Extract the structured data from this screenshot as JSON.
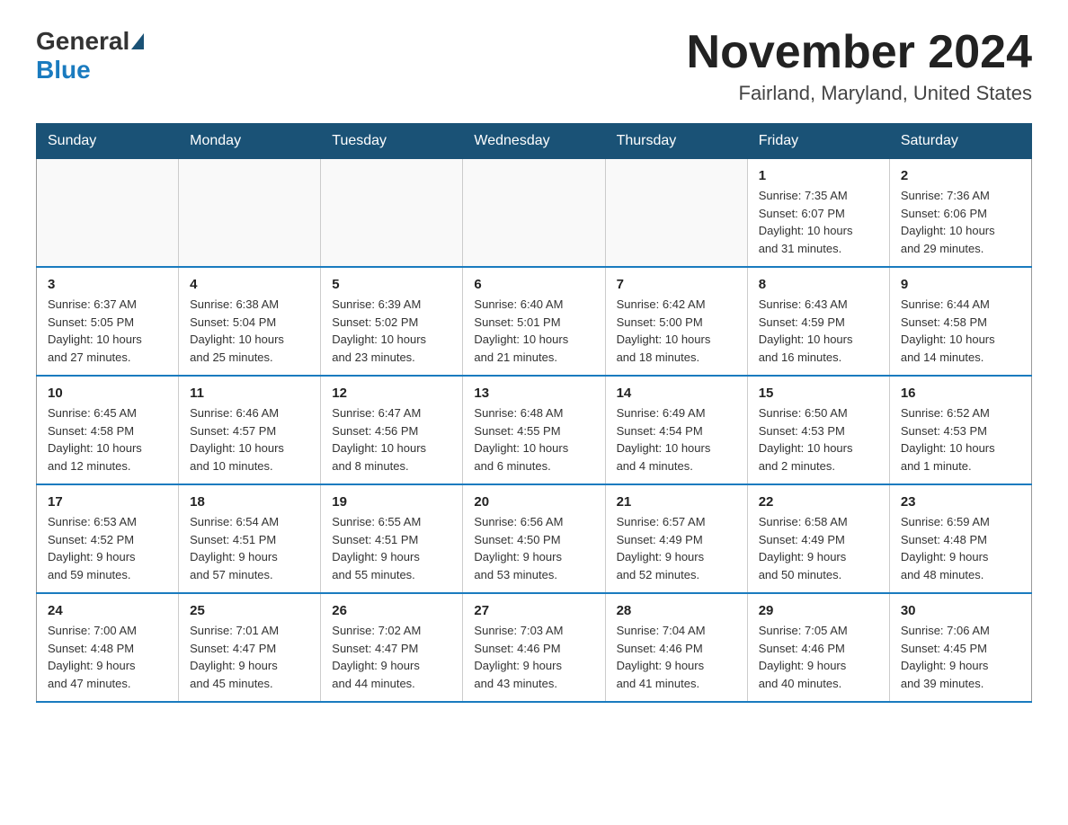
{
  "header": {
    "logo_general": "General",
    "logo_blue": "Blue",
    "month_title": "November 2024",
    "location": "Fairland, Maryland, United States"
  },
  "weekdays": [
    "Sunday",
    "Monday",
    "Tuesday",
    "Wednesday",
    "Thursday",
    "Friday",
    "Saturday"
  ],
  "weeks": [
    [
      {
        "day": "",
        "info": ""
      },
      {
        "day": "",
        "info": ""
      },
      {
        "day": "",
        "info": ""
      },
      {
        "day": "",
        "info": ""
      },
      {
        "day": "",
        "info": ""
      },
      {
        "day": "1",
        "info": "Sunrise: 7:35 AM\nSunset: 6:07 PM\nDaylight: 10 hours\nand 31 minutes."
      },
      {
        "day": "2",
        "info": "Sunrise: 7:36 AM\nSunset: 6:06 PM\nDaylight: 10 hours\nand 29 minutes."
      }
    ],
    [
      {
        "day": "3",
        "info": "Sunrise: 6:37 AM\nSunset: 5:05 PM\nDaylight: 10 hours\nand 27 minutes."
      },
      {
        "day": "4",
        "info": "Sunrise: 6:38 AM\nSunset: 5:04 PM\nDaylight: 10 hours\nand 25 minutes."
      },
      {
        "day": "5",
        "info": "Sunrise: 6:39 AM\nSunset: 5:02 PM\nDaylight: 10 hours\nand 23 minutes."
      },
      {
        "day": "6",
        "info": "Sunrise: 6:40 AM\nSunset: 5:01 PM\nDaylight: 10 hours\nand 21 minutes."
      },
      {
        "day": "7",
        "info": "Sunrise: 6:42 AM\nSunset: 5:00 PM\nDaylight: 10 hours\nand 18 minutes."
      },
      {
        "day": "8",
        "info": "Sunrise: 6:43 AM\nSunset: 4:59 PM\nDaylight: 10 hours\nand 16 minutes."
      },
      {
        "day": "9",
        "info": "Sunrise: 6:44 AM\nSunset: 4:58 PM\nDaylight: 10 hours\nand 14 minutes."
      }
    ],
    [
      {
        "day": "10",
        "info": "Sunrise: 6:45 AM\nSunset: 4:58 PM\nDaylight: 10 hours\nand 12 minutes."
      },
      {
        "day": "11",
        "info": "Sunrise: 6:46 AM\nSunset: 4:57 PM\nDaylight: 10 hours\nand 10 minutes."
      },
      {
        "day": "12",
        "info": "Sunrise: 6:47 AM\nSunset: 4:56 PM\nDaylight: 10 hours\nand 8 minutes."
      },
      {
        "day": "13",
        "info": "Sunrise: 6:48 AM\nSunset: 4:55 PM\nDaylight: 10 hours\nand 6 minutes."
      },
      {
        "day": "14",
        "info": "Sunrise: 6:49 AM\nSunset: 4:54 PM\nDaylight: 10 hours\nand 4 minutes."
      },
      {
        "day": "15",
        "info": "Sunrise: 6:50 AM\nSunset: 4:53 PM\nDaylight: 10 hours\nand 2 minutes."
      },
      {
        "day": "16",
        "info": "Sunrise: 6:52 AM\nSunset: 4:53 PM\nDaylight: 10 hours\nand 1 minute."
      }
    ],
    [
      {
        "day": "17",
        "info": "Sunrise: 6:53 AM\nSunset: 4:52 PM\nDaylight: 9 hours\nand 59 minutes."
      },
      {
        "day": "18",
        "info": "Sunrise: 6:54 AM\nSunset: 4:51 PM\nDaylight: 9 hours\nand 57 minutes."
      },
      {
        "day": "19",
        "info": "Sunrise: 6:55 AM\nSunset: 4:51 PM\nDaylight: 9 hours\nand 55 minutes."
      },
      {
        "day": "20",
        "info": "Sunrise: 6:56 AM\nSunset: 4:50 PM\nDaylight: 9 hours\nand 53 minutes."
      },
      {
        "day": "21",
        "info": "Sunrise: 6:57 AM\nSunset: 4:49 PM\nDaylight: 9 hours\nand 52 minutes."
      },
      {
        "day": "22",
        "info": "Sunrise: 6:58 AM\nSunset: 4:49 PM\nDaylight: 9 hours\nand 50 minutes."
      },
      {
        "day": "23",
        "info": "Sunrise: 6:59 AM\nSunset: 4:48 PM\nDaylight: 9 hours\nand 48 minutes."
      }
    ],
    [
      {
        "day": "24",
        "info": "Sunrise: 7:00 AM\nSunset: 4:48 PM\nDaylight: 9 hours\nand 47 minutes."
      },
      {
        "day": "25",
        "info": "Sunrise: 7:01 AM\nSunset: 4:47 PM\nDaylight: 9 hours\nand 45 minutes."
      },
      {
        "day": "26",
        "info": "Sunrise: 7:02 AM\nSunset: 4:47 PM\nDaylight: 9 hours\nand 44 minutes."
      },
      {
        "day": "27",
        "info": "Sunrise: 7:03 AM\nSunset: 4:46 PM\nDaylight: 9 hours\nand 43 minutes."
      },
      {
        "day": "28",
        "info": "Sunrise: 7:04 AM\nSunset: 4:46 PM\nDaylight: 9 hours\nand 41 minutes."
      },
      {
        "day": "29",
        "info": "Sunrise: 7:05 AM\nSunset: 4:46 PM\nDaylight: 9 hours\nand 40 minutes."
      },
      {
        "day": "30",
        "info": "Sunrise: 7:06 AM\nSunset: 4:45 PM\nDaylight: 9 hours\nand 39 minutes."
      }
    ]
  ]
}
